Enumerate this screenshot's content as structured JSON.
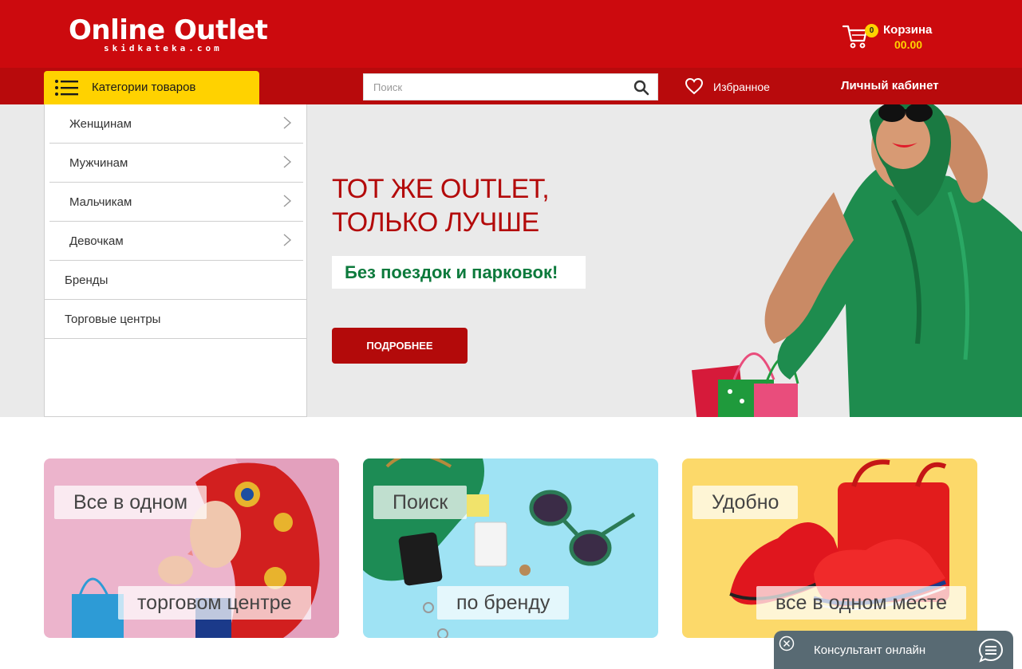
{
  "header": {
    "logo_title": "Online Outlet",
    "logo_subtitle": "skidkateka.com",
    "cart_label": "Корзина",
    "cart_count": "0",
    "cart_total": "00.00",
    "categories_label": "Категории товаров",
    "search_placeholder": "Поиск",
    "favorites_label": "Избранное",
    "account_label": "Личный кабинет"
  },
  "menu": {
    "items": [
      {
        "label": "Женщинам",
        "icon": "chevron-right-icon"
      },
      {
        "label": "Мужчинам",
        "icon": "chevron-right-icon"
      },
      {
        "label": "Мальчикам",
        "icon": "chevron-right-icon"
      },
      {
        "label": "Девочкам",
        "icon": "chevron-right-icon"
      },
      {
        "label": "Бренды"
      },
      {
        "label": "Торговые центры"
      }
    ]
  },
  "hero": {
    "title_line1": "ТОТ ЖЕ OUTLET,",
    "title_line2": "ТОЛЬКО ЛУЧШЕ",
    "subtitle": "Без поездок и парковок!",
    "button_label": "ПОДРОБНЕЕ"
  },
  "cards": [
    {
      "top": "Все в одном",
      "bottom": "торговом центре"
    },
    {
      "top": "Поиск",
      "bottom": "по бренду"
    },
    {
      "top": "Удобно",
      "bottom": "все в одном месте"
    }
  ],
  "consultant": {
    "label": "Консультант онлайн"
  },
  "colors": {
    "brand_red": "#cc0a0e",
    "bar_red": "#b80a0c",
    "accent_yellow": "#ffd200",
    "accent_green": "#0c7a3c",
    "consultant_bg": "#586a73"
  }
}
